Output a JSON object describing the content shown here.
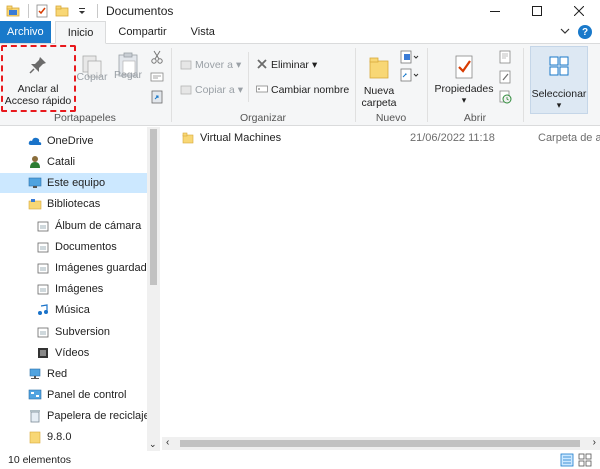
{
  "window": {
    "title": "Documentos"
  },
  "ribbon_tabs": {
    "file": "Archivo",
    "home": "Inicio",
    "share": "Compartir",
    "view": "Vista"
  },
  "ribbon": {
    "clipboard": {
      "pin_label_1": "Anclar al",
      "pin_label_2": "Acceso rápido",
      "copy": "Copiar",
      "paste": "Pegar",
      "group_label": "Portapapeles"
    },
    "organize": {
      "move_to": "Mover a",
      "copy_to": "Copiar a",
      "delete": "Eliminar",
      "rename": "Cambiar nombre",
      "group_label": "Organizar"
    },
    "new": {
      "new_folder_1": "Nueva",
      "new_folder_2": "carpeta",
      "group_label": "Nuevo"
    },
    "open": {
      "properties": "Propiedades",
      "group_label": "Abrir"
    },
    "select": {
      "label": "Seleccionar"
    }
  },
  "nav": {
    "items": [
      {
        "label": "OneDrive",
        "icon": "cloud-icon"
      },
      {
        "label": "Catali",
        "icon": "user-icon"
      },
      {
        "label": "Este equipo",
        "icon": "computer-icon"
      },
      {
        "label": "Bibliotecas",
        "icon": "libraries-icon"
      },
      {
        "label": "Álbum de cámara",
        "icon": "library-folder-icon"
      },
      {
        "label": "Documentos",
        "icon": "library-folder-icon"
      },
      {
        "label": "Imágenes guardadas",
        "icon": "library-folder-icon"
      },
      {
        "label": "Imágenes",
        "icon": "library-folder-icon"
      },
      {
        "label": "Música",
        "icon": "music-icon"
      },
      {
        "label": "Subversion",
        "icon": "library-folder-icon"
      },
      {
        "label": "Vídeos",
        "icon": "video-icon"
      },
      {
        "label": "Red",
        "icon": "network-icon"
      },
      {
        "label": "Panel de control",
        "icon": "control-panel-icon"
      },
      {
        "label": "Papelera de reciclaje",
        "icon": "recycle-bin-icon"
      },
      {
        "label": "9.8.0",
        "icon": "folder-icon"
      }
    ]
  },
  "files": [
    {
      "name": "Virtual Machines",
      "date": "21/06/2022 11:18",
      "type": "Carpeta de a"
    }
  ],
  "status": {
    "count": "10 elementos"
  },
  "colors": {
    "file_tab": "#1979ca",
    "selected": "#cce8ff",
    "highlight": "#e8191d",
    "folder": "#f8d775"
  }
}
